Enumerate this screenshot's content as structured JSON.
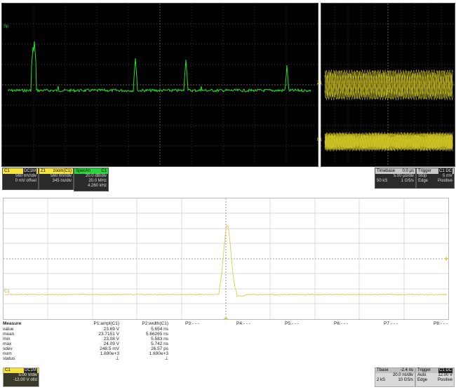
{
  "top_scope": {
    "channel_marker_label": "Sp",
    "trace_labels": {
      "zoom_top": "Z1",
      "zoom_bottom": "F1"
    },
    "tiles": [
      {
        "name": "C1",
        "tag": "DC1M",
        "lines": [
          "560 mV/div",
          "0 mV offset"
        ],
        "color": "#f5e23a"
      },
      {
        "name": "Z1",
        "tag": "zoom(C1)",
        "lines": [
          "560 mV/div",
          "345 ns/div"
        ],
        "color": "#f5e23a"
      },
      {
        "name": "SpecAn",
        "tag": "C1",
        "lines": [
          "20.0 dB/div",
          "20.0 MHz",
          "4.260 kHz"
        ],
        "color": "#27d43b"
      }
    ],
    "timebase": {
      "title": "Timebase",
      "value": "0.0 µs",
      "line1": "5.00 µs/div",
      "line2_a": "50 kS",
      "line2_b": "1 GS/s"
    },
    "trigger": {
      "title": "Trigger",
      "tag": "C1 DC",
      "line1_a": "Stop",
      "line1_b": "5 mV",
      "line2_a": "Edge",
      "line2_b": "Positive"
    }
  },
  "bottom_scope": {
    "channel_label": "C1",
    "measure": {
      "headers": [
        "Measure",
        "P1:ampl(C1)",
        "P2:width(C1)",
        "P3:- - -",
        "P4:- - -",
        "P5:- - -",
        "P6:- - -",
        "P7:- - -",
        "P8:- - -"
      ],
      "rows": [
        {
          "label": "value",
          "p1": "23.69 V",
          "p2": "5.654 ns"
        },
        {
          "label": "mean",
          "p1": "23.7151 V",
          "p2": "5.66265 ns"
        },
        {
          "label": "min",
          "p1": "23.08 V",
          "p2": "5.583 ns"
        },
        {
          "label": "max",
          "p1": "24.09 V",
          "p2": "5.742 ns"
        },
        {
          "label": "sdev",
          "p1": "248.5 mV",
          "p2": "26.57 ps"
        },
        {
          "label": "num",
          "p1": "1.690e+3",
          "p2": "1.690e+3"
        },
        {
          "label": "status",
          "p1": "⊥",
          "p2": "⊥"
        }
      ]
    },
    "c1_tile": {
      "name": "C1",
      "tag": "DC1M",
      "line1": "5.00 V/div",
      "line2": "-12.00 V ofst"
    },
    "tbase": {
      "title": "Tbase",
      "value": "-2.4 ns",
      "line1": "20.0 ns/div",
      "line2_a": "2 kS",
      "line2_b": "10 GS/s"
    },
    "trigger": {
      "title": "Trigger",
      "tag": "C1 DC",
      "line1_a": "Auto",
      "line1_b": "12.00 V",
      "line2_a": "Edge",
      "line2_b": "Positive"
    }
  },
  "colors": {
    "spectrum_trace": "#22e02a",
    "signal_trace": "#e8dc2a",
    "bottom_trace": "#d8d050",
    "grid_top": "#5a5a5a",
    "grid_bottom": "#cfcfcf",
    "tile_bg": "#2a2a2a"
  }
}
